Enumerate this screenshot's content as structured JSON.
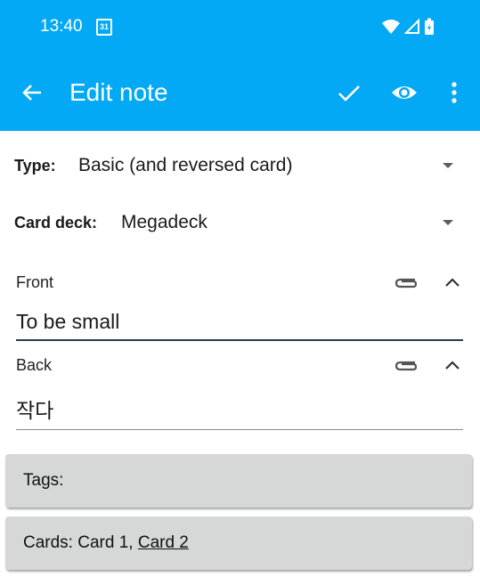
{
  "colors": {
    "appbar": "#03a9f4",
    "focused_underline": "#263b4c",
    "panel": "#d6d7d7"
  },
  "status_bar": {
    "time": "13:40",
    "calendar_day": "31",
    "icons": [
      "wifi-icon",
      "cell-signal-icon",
      "battery-charging-icon"
    ]
  },
  "toolbar": {
    "title": "Edit note",
    "actions": [
      {
        "name": "save",
        "icon": "check-icon"
      },
      {
        "name": "preview",
        "icon": "eye-icon"
      },
      {
        "name": "more",
        "icon": "more-vert-icon"
      }
    ]
  },
  "note_type": {
    "label": "Type:",
    "value": "Basic (and reversed card)"
  },
  "deck": {
    "label": "Card deck:",
    "value": "Megadeck"
  },
  "fields": [
    {
      "label": "Front",
      "value": "To be small"
    },
    {
      "label": "Back",
      "value": "작다"
    }
  ],
  "tags": {
    "label": "Tags:"
  },
  "cards": {
    "label": "Cards:",
    "card1": "Card 1,",
    "card2": "Card 2"
  }
}
